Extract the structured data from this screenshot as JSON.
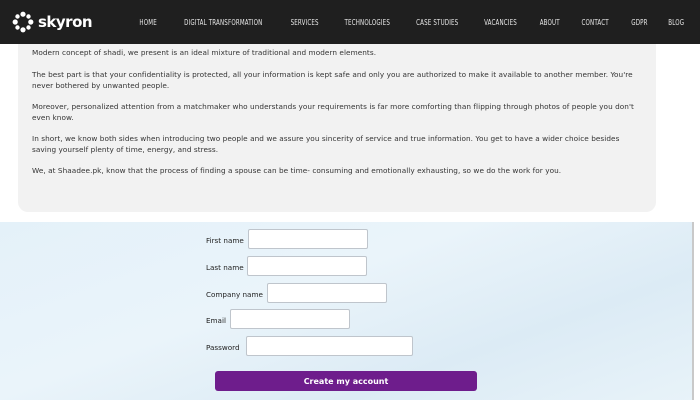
{
  "brand": {
    "name": "skyron",
    "logo_icon": "skyron-logo-icon"
  },
  "nav": {
    "items": [
      {
        "label": "HOME"
      },
      {
        "label": "DIGITAL TRANSFORMATION"
      },
      {
        "label": "SERVICES"
      },
      {
        "label": "TECHNOLOGIES"
      },
      {
        "label": "CASE STUDIES"
      },
      {
        "label": "VACANCIES"
      },
      {
        "label": "ABOUT"
      },
      {
        "label": "CONTACT"
      },
      {
        "label": "GDPR"
      },
      {
        "label": "BLOG"
      }
    ]
  },
  "content": {
    "paragraphs": [
      "Modern concept of shadi, we present is an ideal mixture of traditional and modern elements.",
      "The best part is that your confidentiality is protected, all your information is kept safe and only you are authorized to make it available to another member. You're never bothered by unwanted people.",
      "Moreover, personalized attention from a matchmaker who understands your requirements is far more comforting than flipping through photos of people you don't even know.",
      "In short, we know both sides when introducing two people and we assure you sincerity of service and true information. You get to have a wider choice besides saving yourself plenty of time, energy, and stress.",
      "We, at Shaadee.pk, know that the process of finding a spouse can be time- consuming and emotionally exhausting, so we do the work for you."
    ]
  },
  "form": {
    "first_name_label": "First name",
    "first_name_value": "",
    "last_name_label": "Last name",
    "last_name_value": "",
    "company_name_label": "Company name",
    "company_name_value": "",
    "email_label": "Email",
    "email_value": "",
    "password_label": "Password",
    "password_value": "",
    "submit_label": "Create my account"
  },
  "colors": {
    "topbar": "#1f1f1f",
    "card": "#f2f2f2",
    "button": "#6e1d8c",
    "form_bg": "#e4f1f9"
  }
}
